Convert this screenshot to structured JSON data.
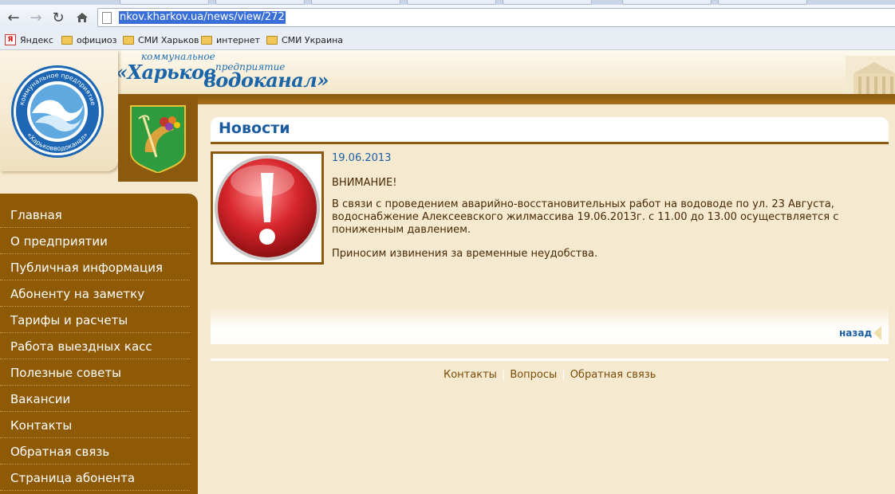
{
  "browser": {
    "url": "nkov.kharkov.ua/news/view/272",
    "bookmarks": [
      "Яндекс",
      "официоз",
      "СМИ Харьков",
      "интернет",
      "СМИ Украина"
    ]
  },
  "site": {
    "logo_small_1": "коммунальное",
    "logo_small_2": "предприятие",
    "logo_big_1": "«Харьков",
    "logo_big_2": "водоканал»",
    "round_logo_text_top": "коммунальное предприятие",
    "round_logo_text_bottom": "«Харьковводоканал»"
  },
  "sidebar": {
    "items": [
      "Главная",
      "О предприятии",
      "Публичная информация",
      "Абоненту на заметку",
      "Тарифы и расчеты",
      "Работа выездных касс",
      "Полезные советы",
      "Вакансии",
      "Контакты",
      "Обратная связь",
      "Страница абонента"
    ]
  },
  "news": {
    "section_title": "Новости",
    "date": "19.06.2013",
    "heading": "ВНИМАНИЕ!",
    "body": "В связи с проведением аварийно-восстановительных работ на водоводе по ул. 23 Августа, водоснабжение Алексеевского жилмассива 19.06.2013г. с 11.00 до 13.00 осуществляется с пониженным давлением.",
    "apology": "Приносим извинения за временные неудобства.",
    "back_label": "назад"
  },
  "footer": {
    "links": [
      "Контакты",
      "Вопросы",
      "Обратная связь"
    ]
  },
  "colors": {
    "brown": "#8e5a06",
    "link_blue": "#1a5fa6",
    "background": "#f5e9cf"
  }
}
